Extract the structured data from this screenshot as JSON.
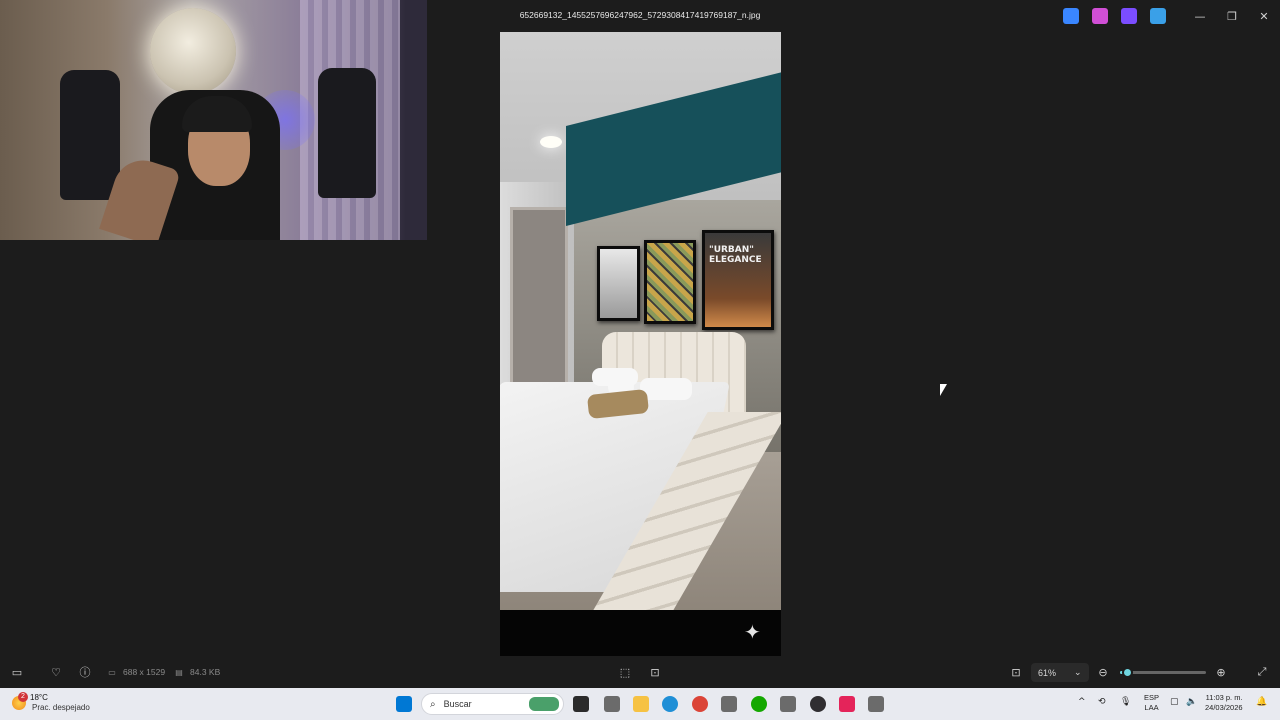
{
  "window": {
    "title": "652669132_1455257696247962_5729308417419769187_n.jpg",
    "controls": {
      "minimize": "—",
      "maximize": "❐",
      "close": "✕"
    },
    "title_apps": [
      {
        "name": "photos-edit-icon",
        "color": "#3a86ff"
      },
      {
        "name": "designer-icon",
        "color": "#d14fd6"
      },
      {
        "name": "clipchamp-icon",
        "color": "#7b4dff"
      },
      {
        "name": "onedrive-off-icon",
        "color": "#3aa0e8"
      }
    ]
  },
  "photo": {
    "poster_text": "\"URBAN\" ELEGANCE",
    "sparkle": "✦"
  },
  "toolbar": {
    "dimensions": "688 x 1529",
    "file_size": "84.3 KB",
    "zoom_value": "61%",
    "zoom_level": 0.08,
    "icons": {
      "filmstrip": "▭",
      "favorite": "♡",
      "info": "ⓘ",
      "rotate": "⟳",
      "crop": "⬚",
      "fit": "⊡",
      "zoom_out": "⊖",
      "zoom_in": "⊕",
      "fullscreen": "⤢",
      "dropdown": "⌄"
    }
  },
  "taskbar": {
    "weather_temp": "18°C",
    "weather_desc": "Prac. despejado",
    "weather_badge": "2",
    "search_placeholder": "Buscar",
    "lang_line1": "ESP",
    "lang_line2": "LAA",
    "time": "11:03 p. m.",
    "date": "24/03/2026",
    "apps": [
      {
        "name": "start-icon",
        "color": "#0078d4"
      },
      {
        "name": "widgets-icon",
        "color": "#4aa06a"
      },
      {
        "name": "task-view-icon",
        "color": "#2b2b2b"
      },
      {
        "name": "app-gray-1-icon",
        "color": "#6b6b6b"
      },
      {
        "name": "file-explorer-icon",
        "color": "#f6c243"
      },
      {
        "name": "edge-icon",
        "color": "#1f8fd6"
      },
      {
        "name": "chrome-icon",
        "color": "#db4437"
      },
      {
        "name": "app-gray-2-icon",
        "color": "#6b6b6b"
      },
      {
        "name": "upwork-icon",
        "color": "#14a800"
      },
      {
        "name": "app-gray-3-icon",
        "color": "#6b6b6b"
      },
      {
        "name": "obs-icon",
        "color": "#302e31"
      },
      {
        "name": "tiktok-icon",
        "color": "#e4245a"
      },
      {
        "name": "app-gray-4-icon",
        "color": "#6b6b6b"
      }
    ],
    "tray_icons": {
      "chevron": "^",
      "sync": "⟲",
      "mic": "🎙",
      "display": "▢",
      "volume": "🔈",
      "notifications": "🔔"
    }
  }
}
